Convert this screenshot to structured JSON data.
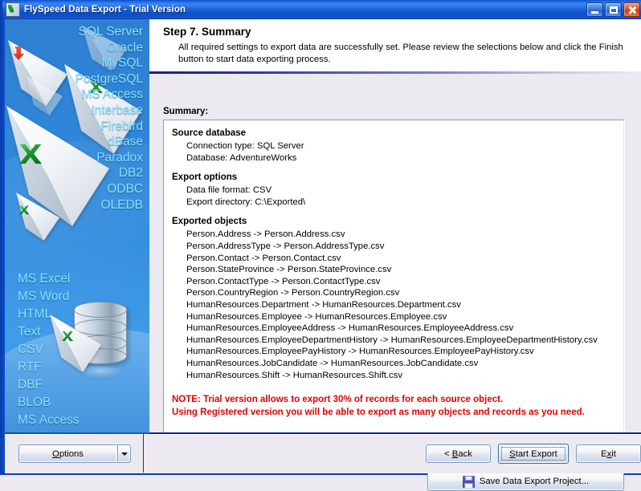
{
  "window": {
    "title": "FlySpeed Data Export - Trial Version",
    "icon": "app-icon",
    "controls": {
      "minimize": "minimize-icon",
      "maximize": "maximize-icon",
      "close": "close-icon"
    }
  },
  "banner": {
    "databases": [
      "SQL Server",
      "Oracle",
      "MySQL",
      "PostgreSQL",
      "MS Access",
      "Interbase",
      "Firebird",
      "dBase",
      "Paradox",
      "DB2",
      "ODBC",
      "OLEDB"
    ],
    "formats": [
      "MS Excel",
      "MS Word",
      "HTML",
      "Text",
      "CSV",
      "RTF",
      "DBF",
      "BLOB",
      "MS Access"
    ],
    "accent_color": "#87e2ff",
    "background_color": "#2f86d8"
  },
  "pane": {
    "step_title": "Step 7. Summary",
    "step_description": "All required settings to export data are successfully set. Please review the selections below and click the Finish button to start data exporting process.",
    "summary_label": "Summary:"
  },
  "summary": {
    "sections": [
      {
        "heading": "Source database",
        "lines": [
          "Connection type: SQL Server",
          "Database: AdventureWorks"
        ]
      },
      {
        "heading": "Export options",
        "lines": [
          "Data file format: CSV",
          "Export directory: C:\\Exported\\"
        ]
      },
      {
        "heading": "Exported objects",
        "lines": [
          "Person.Address  ->  Person.Address.csv",
          "Person.AddressType  ->  Person.AddressType.csv",
          "Person.Contact  ->  Person.Contact.csv",
          "Person.StateProvince  ->  Person.StateProvince.csv",
          "Person.ContactType  ->  Person.ContactType.csv",
          "Person.CountryRegion  ->  Person.CountryRegion.csv",
          "HumanResources.Department  ->  HumanResources.Department.csv",
          "HumanResources.Employee  ->  HumanResources.Employee.csv",
          "HumanResources.EmployeeAddress  ->  HumanResources.EmployeeAddress.csv",
          "HumanResources.EmployeeDepartmentHistory  ->  HumanResources.EmployeeDepartmentHistory.csv",
          "HumanResources.EmployeePayHistory  ->  HumanResources.EmployeePayHistory.csv",
          "HumanResources.JobCandidate  ->  HumanResources.JobCandidate.csv",
          "HumanResources.Shift  ->  HumanResources.Shift.csv"
        ]
      }
    ],
    "note_line1": "NOTE: Trial version allows to export 30% of records for each source object.",
    "note_line2": "Using Registered version you will  be able to export as many objects and records as you need.",
    "note_color": "#e40000"
  },
  "buttons": {
    "save_project": "Save Data Export Project...",
    "save_project_icon": "floppy-disk-icon",
    "options": "Options",
    "options_accel": "O",
    "options_dropdown": "chevron-down-icon",
    "back": "< Back",
    "back_accel": "B",
    "start_export": "Start Export",
    "start_export_accel": "S",
    "exit": "Exit",
    "exit_accel": "x"
  }
}
